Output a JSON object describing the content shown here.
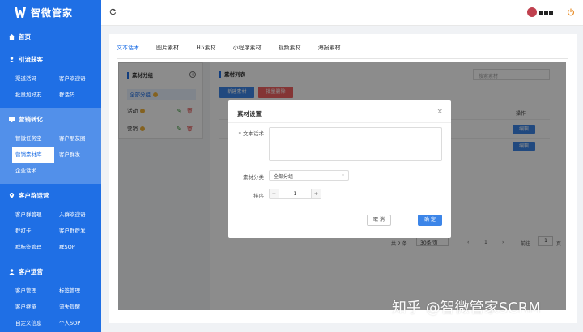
{
  "app": {
    "title": "智微管家"
  },
  "sidebar": {
    "home": "首页",
    "groups": [
      {
        "title": "引流获客",
        "items": [
          "渠道活码",
          "客户欢迎语",
          "批量加好友",
          "群活码"
        ]
      },
      {
        "title": "营销转化",
        "items": [
          "智微任务宝",
          "客户朋友圈",
          "营销素材库",
          "客户群发",
          "企业话术"
        ],
        "active_item": "营销素材库"
      },
      {
        "title": "客户群运营",
        "items": [
          "客户群管理",
          "入群欢迎语",
          "群打卡",
          "客户群群发",
          "群标签管理",
          "群SOP"
        ]
      },
      {
        "title": "客户运营",
        "items": [
          "客户管理",
          "标签管理",
          "客户继承",
          "流失提醒",
          "自定义信息",
          "个人SOP"
        ]
      }
    ]
  },
  "tabs": [
    "文本话术",
    "图片素材",
    "H5素材",
    "小程序素材",
    "视频素材",
    "海报素材"
  ],
  "active_tab": "文本话术",
  "category_panel": {
    "title": "素材分组",
    "items": [
      "全部分组",
      "活动",
      "营销"
    ]
  },
  "list_panel": {
    "title": "素材列表",
    "search_placeholder": "搜索素材",
    "new_button": "新建素材",
    "batch_delete_button": "批量删除",
    "op_header": "操作",
    "edit_label": "编辑",
    "pagination": {
      "total": "共 2 条",
      "page_size": "30条/页",
      "current_page": "1",
      "goto_label": "前往",
      "goto_value": "1",
      "page_suffix": "页"
    }
  },
  "modal": {
    "title": "素材设置",
    "text_label": "* 文本话术",
    "category_label": "素材分类",
    "category_value": "全部分组",
    "sort_label": "排序",
    "sort_value": "1",
    "cancel": "取 消",
    "confirm": "确 定"
  },
  "watermark": "知乎 @智微管家SCRM",
  "colors": {
    "brand": "#1f6fe5",
    "danger": "#f06262",
    "active_group": "#5290ea"
  }
}
